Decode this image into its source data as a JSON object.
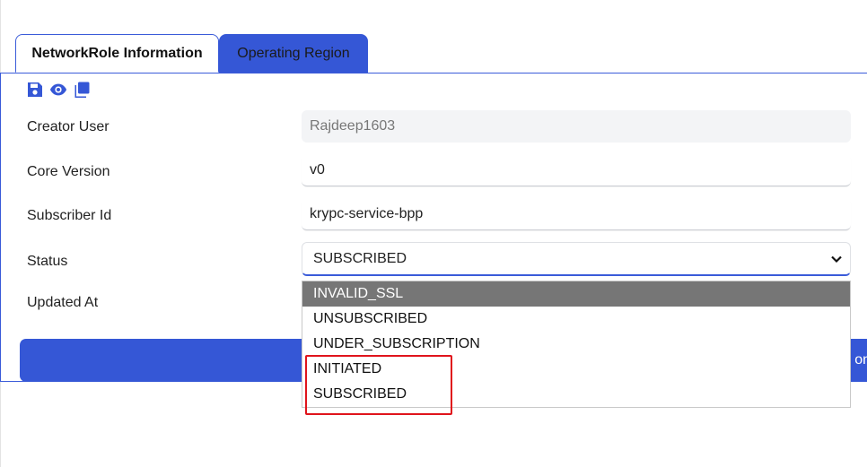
{
  "tabs": [
    {
      "label": "NetworkRole Information",
      "active": true
    },
    {
      "label": "Operating Region",
      "active": false
    }
  ],
  "toolbar": {
    "icons": [
      "save-icon",
      "view-icon",
      "copy-icon"
    ],
    "accent_color": "#3557d6"
  },
  "form": {
    "creator_user": {
      "label": "Creator User",
      "value": "Rajdeep1603"
    },
    "core_version": {
      "label": "Core Version",
      "value": "v0"
    },
    "subscriber_id": {
      "label": "Subscriber Id",
      "value": "krypc-service-bpp"
    },
    "status": {
      "label": "Status",
      "value": "SUBSCRIBED"
    },
    "updated_at": {
      "label": "Updated At"
    }
  },
  "submit": {
    "label_partial": "on"
  },
  "status_dropdown": {
    "options": [
      "INVALID_SSL",
      "UNSUBSCRIBED",
      "UNDER_SUBSCRIPTION",
      "INITIATED",
      "SUBSCRIBED"
    ],
    "hovered": "INVALID_SSL",
    "annotated": [
      "INITIATED",
      "SUBSCRIBED"
    ],
    "annotation_color": "#e0141c"
  }
}
